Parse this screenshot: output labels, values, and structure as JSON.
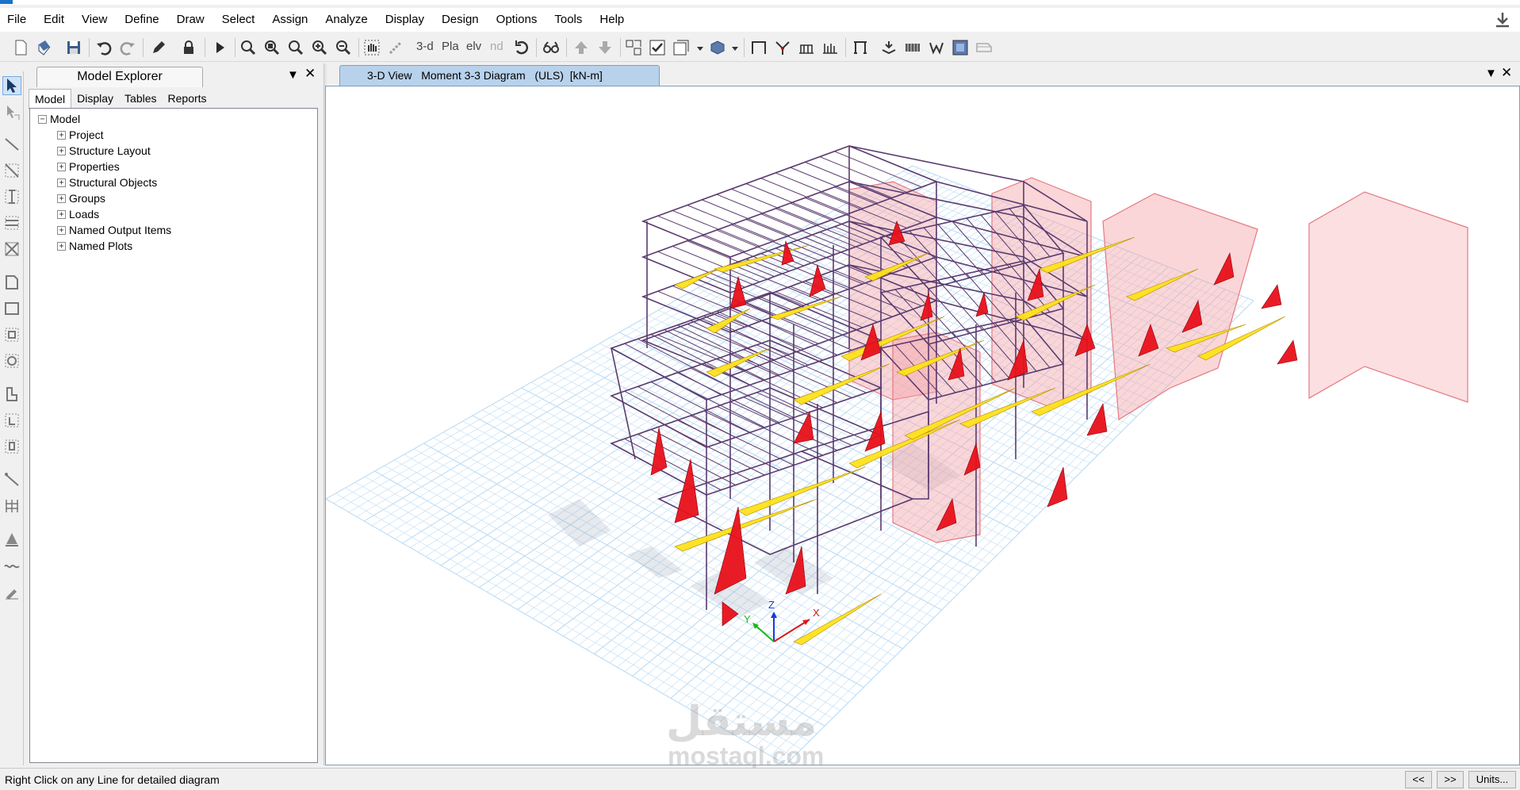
{
  "menu": [
    "File",
    "Edit",
    "View",
    "Define",
    "Draw",
    "Select",
    "Assign",
    "Analyze",
    "Display",
    "Design",
    "Options",
    "Tools",
    "Help"
  ],
  "toolbar": {
    "view_3d": "3-d",
    "view_plan": "Pla",
    "view_elev": "elv",
    "view_nd": "nd"
  },
  "explorer": {
    "title": "Model Explorer",
    "tabs": [
      "Model",
      "Display",
      "Tables",
      "Reports"
    ],
    "active_tab": "Model",
    "tree_root": "Model",
    "tree_items": [
      "Project",
      "Structure Layout",
      "Properties",
      "Structural Objects",
      "Groups",
      "Loads",
      "Named Output Items",
      "Named Plots"
    ]
  },
  "view": {
    "tab_label": "3-D View   Moment 3-3 Diagram   (ULS)  [kN-m]",
    "axis_x": "X",
    "axis_y": "Y",
    "axis_z": "Z"
  },
  "status": {
    "message": "Right Click on any Line for detailed diagram",
    "prev": "<<",
    "next": ">>",
    "units": "Units..."
  },
  "watermark": {
    "arabic": "مستقل",
    "latin": "mostaql.com"
  },
  "colors": {
    "positive_moment": "#ffe21a",
    "negative_moment": "#e8101a",
    "frame": "#5a3a6e",
    "wall": "#f3a3a8",
    "grid": "#bcdcf5"
  }
}
